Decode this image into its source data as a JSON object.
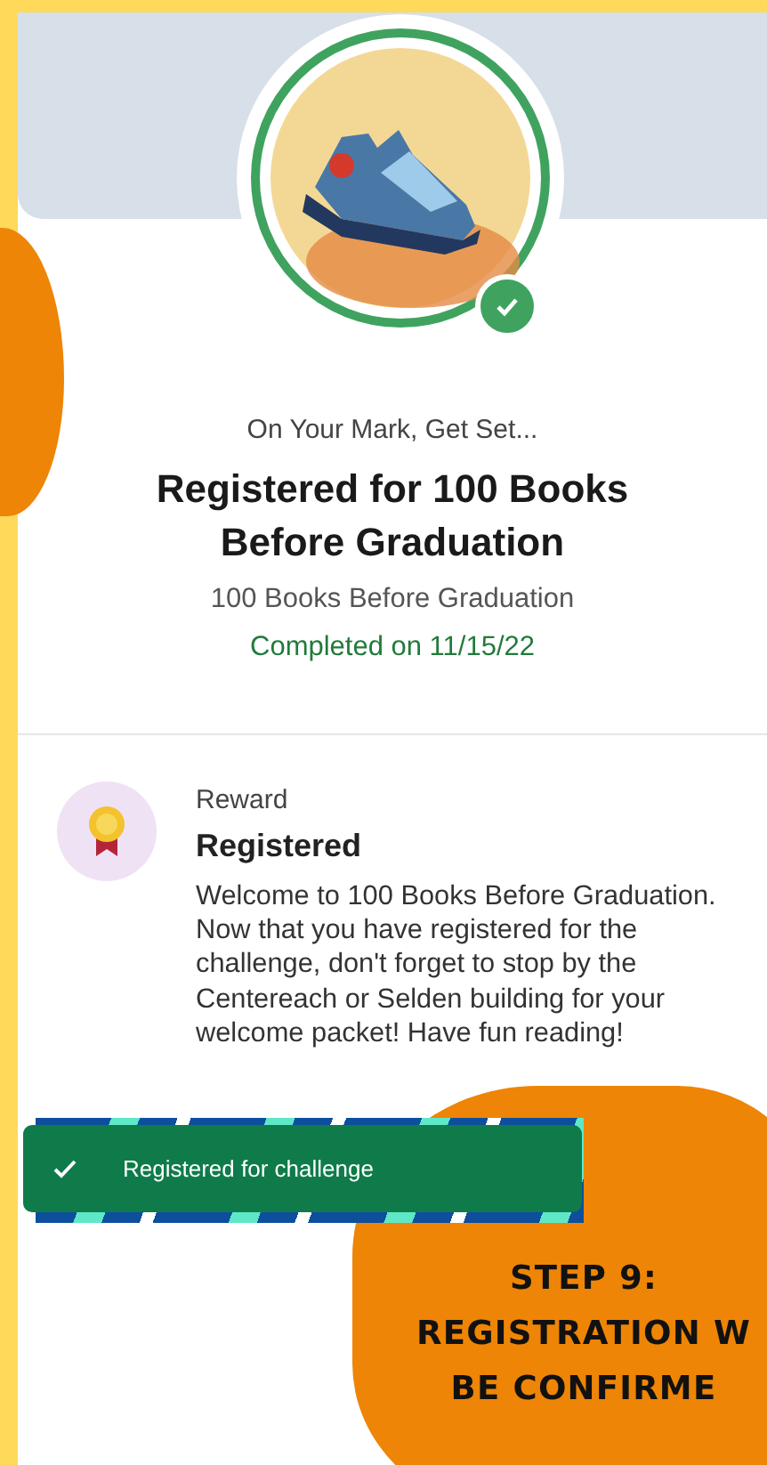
{
  "header": {
    "subtitle": "On Your Mark, Get Set...",
    "title": "Registered for 100 Books Before Graduation",
    "challenge": "100 Books Before Graduation",
    "status": "Completed on 11/15/22",
    "completed": true
  },
  "reward": {
    "label": "Reward",
    "title": "Registered",
    "description": "Welcome to 100 Books Before Graduation. Now that you have registered for the challenge, don't forget to stop by the Centereach or Selden building for your welcome packet! Have fun reading!"
  },
  "toast": {
    "message": "Registered for challenge"
  },
  "callouts": [
    {
      "kind": "side"
    },
    {
      "kind": "step",
      "lines": [
        "STEP 9:",
        "REGISTRATION W",
        "BE CONFIRME"
      ]
    }
  ]
}
